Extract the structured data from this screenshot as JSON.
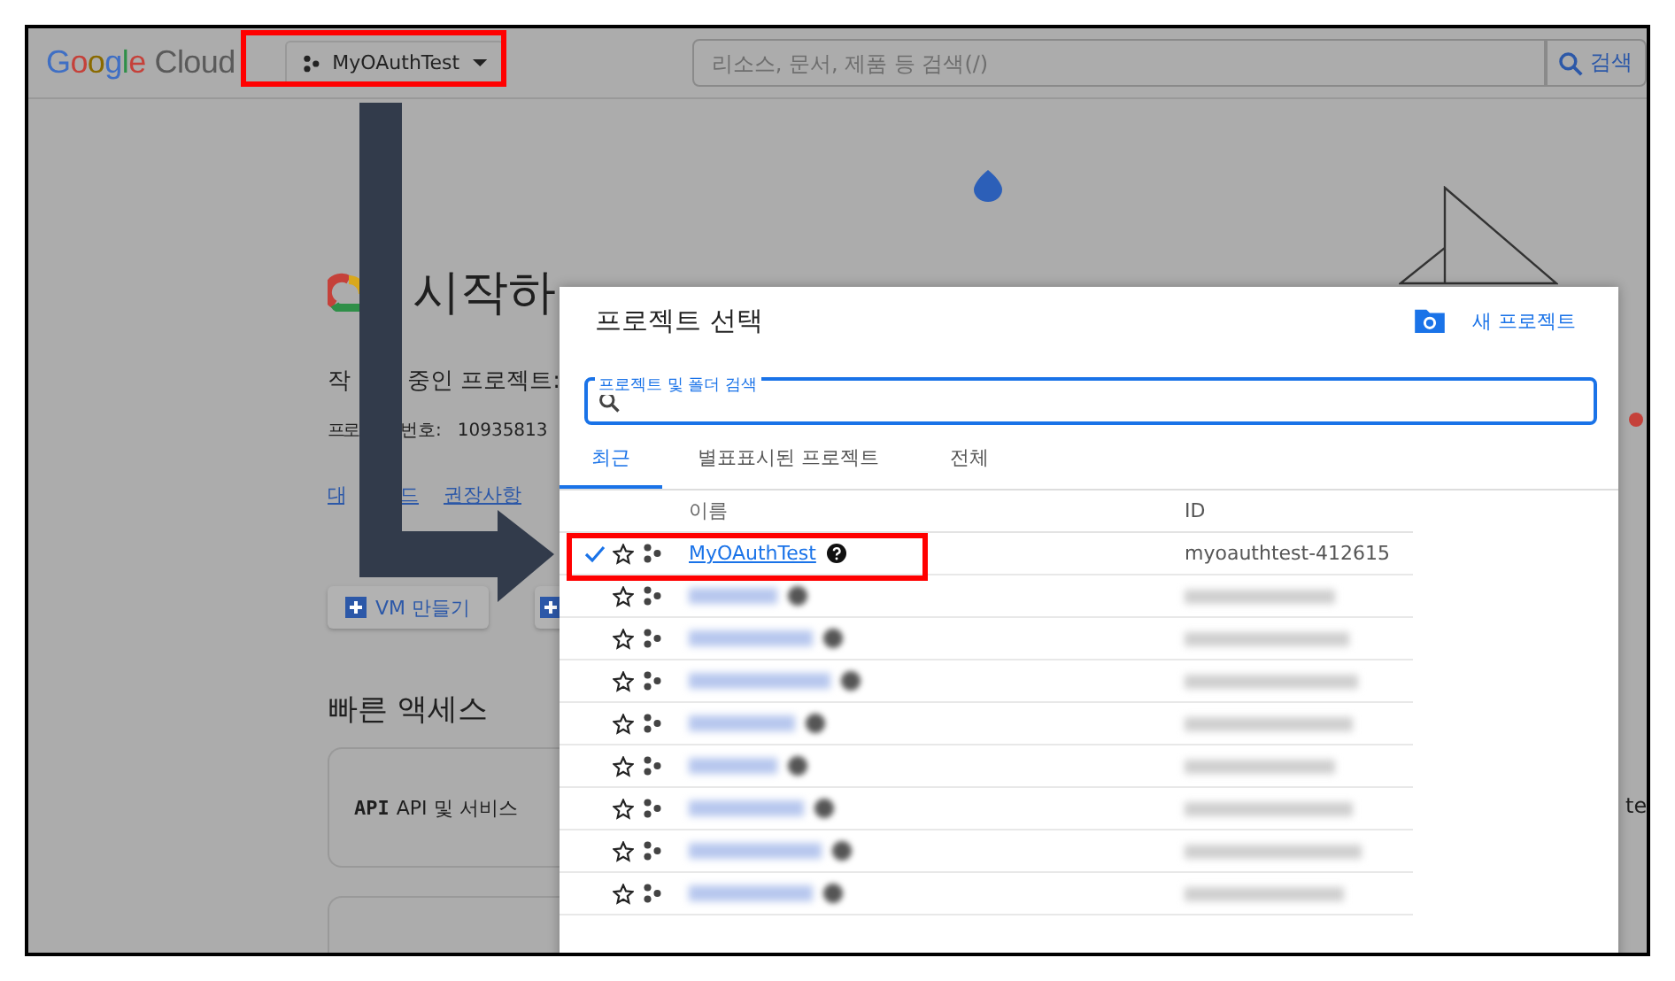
{
  "top_bar": {
    "logo_word": "Google",
    "logo_product": "Cloud",
    "project_picker": "MyOAuthTest",
    "search": {
      "placeholder": "리소스, 문서, 제품 등 검색(/)"
    },
    "search_button": "검색"
  },
  "page": {
    "heading": "시작하",
    "working_project": [
      "작",
      "중인 프로젝트:"
    ],
    "project_number": [
      "프로",
      "번호:",
      "10935813"
    ],
    "links": [
      "대",
      "드",
      "권장사항"
    ],
    "buttons": [
      {
        "label": "VM 만들기"
      }
    ],
    "quick_access_title": "빠른 액세스",
    "cards": [
      {
        "icon_text": "API",
        "label": "API 및 서비스"
      }
    ],
    "edge_text": "te"
  },
  "dialog": {
    "title": "프로젝트 선택",
    "new_project": "새 프로젝트",
    "search": {
      "label": "프로젝트 및 폴더 검색"
    },
    "tabs": [
      {
        "label": "최근",
        "selected": true
      },
      {
        "label": "별표표시된 프로젝트",
        "selected": false
      },
      {
        "label": "전체",
        "selected": false
      }
    ],
    "columns": [
      "이름",
      "ID"
    ],
    "rows": [
      {
        "kind": "named",
        "selected": true,
        "name": "MyOAuthTest",
        "id": "myoauthtest-412615"
      },
      {
        "kind": "blurred",
        "selected": false
      },
      {
        "kind": "blurred",
        "selected": false
      },
      {
        "kind": "blurred",
        "selected": false
      },
      {
        "kind": "blurred",
        "selected": false
      },
      {
        "kind": "blurred",
        "selected": false
      },
      {
        "kind": "blurred",
        "selected": false
      },
      {
        "kind": "blurred",
        "selected": false
      },
      {
        "kind": "blurred",
        "selected": false
      }
    ]
  }
}
